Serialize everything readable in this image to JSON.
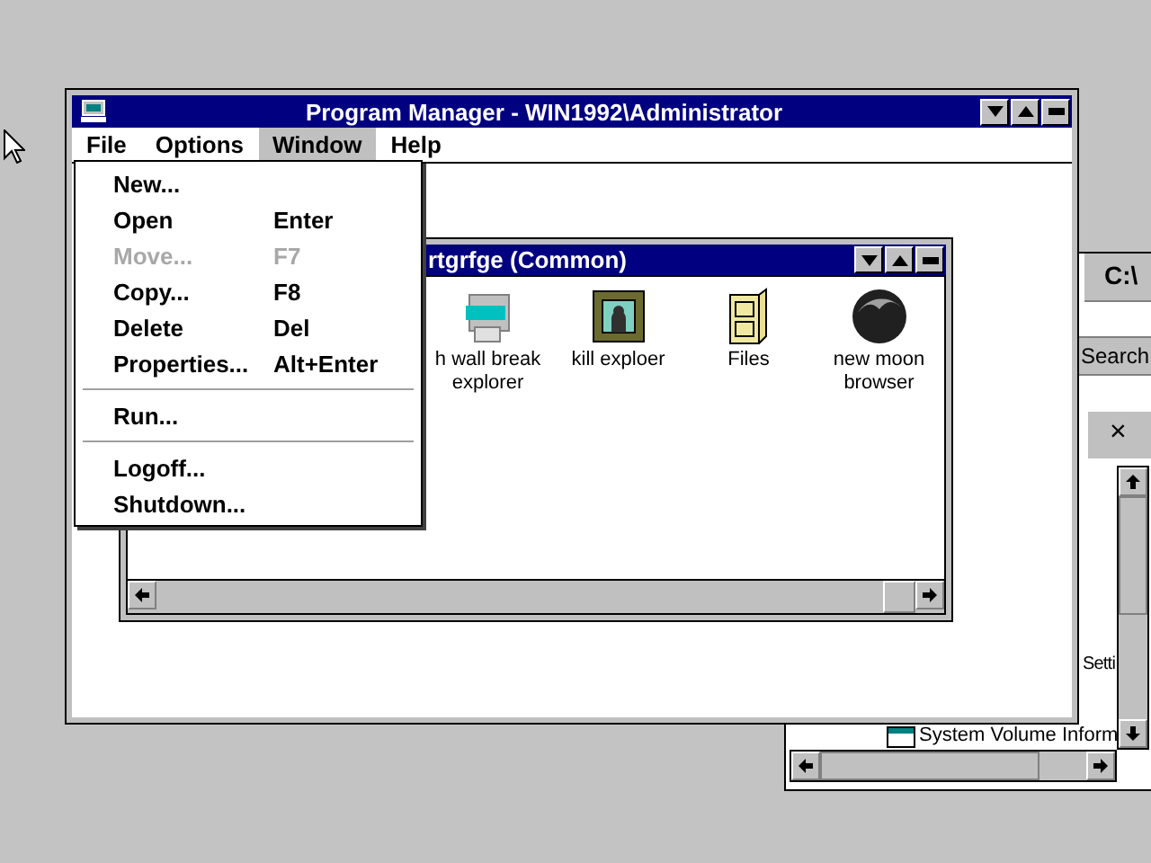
{
  "background_window": {
    "path": "C:\\",
    "search_button": "Search",
    "close_glyph": "×",
    "items": [
      "Setti",
      "System Volume Inform"
    ]
  },
  "program_manager": {
    "title": "Program Manager - WIN1992\\Administrator",
    "menu": [
      {
        "label": "File",
        "highlighted": false
      },
      {
        "label": "Options",
        "highlighted": false
      },
      {
        "label": "Window",
        "highlighted": true
      },
      {
        "label": "Help",
        "highlighted": false
      }
    ]
  },
  "file_menu": [
    {
      "kind": "item",
      "label": "New...",
      "disabled": false
    },
    {
      "kind": "item",
      "label": "Open",
      "shortcut": "Enter",
      "disabled": false
    },
    {
      "kind": "item",
      "label": "Move...",
      "shortcut": "F7",
      "disabled": true
    },
    {
      "kind": "item",
      "label": "Copy...",
      "shortcut": "F8",
      "disabled": false
    },
    {
      "kind": "item",
      "label": "Delete",
      "shortcut": "Del",
      "disabled": false
    },
    {
      "kind": "item",
      "label": "Properties...",
      "shortcut": "Alt+Enter",
      "disabled": false
    },
    {
      "kind": "separator"
    },
    {
      "kind": "item",
      "label": "Run...",
      "disabled": false
    },
    {
      "kind": "separator"
    },
    {
      "kind": "item",
      "label": "Logoff...",
      "disabled": false
    },
    {
      "kind": "item",
      "label": "Shutdown...",
      "disabled": false
    }
  ],
  "group_window": {
    "title": "rtgrfge (Common)",
    "icons": [
      {
        "kind": "computer",
        "label": "h wall break explorer"
      },
      {
        "kind": "portrait",
        "label": "kill exploer"
      },
      {
        "kind": "cabinet",
        "label": "Files"
      },
      {
        "kind": "moon",
        "label": "new moon browser"
      }
    ]
  }
}
